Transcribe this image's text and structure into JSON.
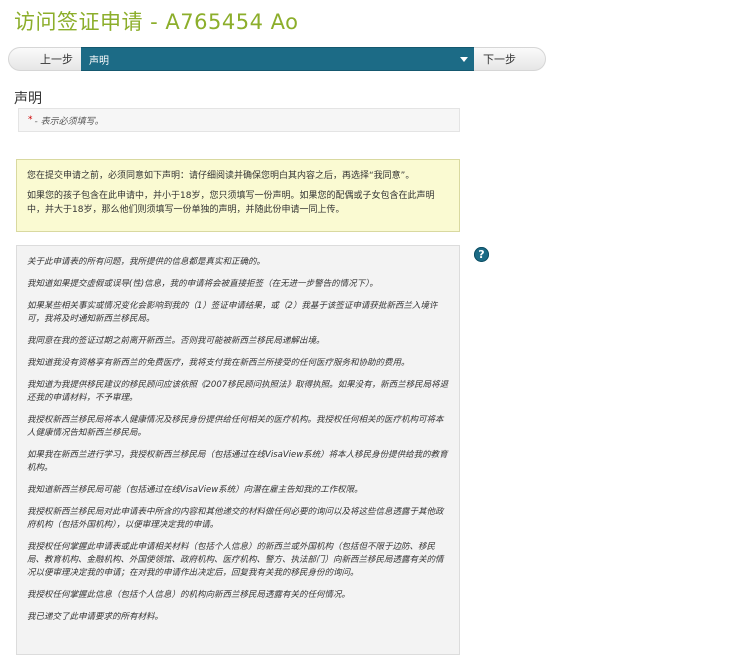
{
  "header": {
    "title": "访问签证申请 - A765454 Ao"
  },
  "nav": {
    "prev_label": "上一步",
    "current_section": "声明",
    "next_label": "下一步"
  },
  "section": {
    "heading": "声明",
    "required_star": "*",
    "required_text": " - 表示必须填写。"
  },
  "notice": {
    "lines": [
      "您在提交申请之前，必须同意如下声明：请仔细阅读并确保您明白其内容之后，再选择“我同意”。",
      "如果您的孩子包含在此申请中，并小于18岁，您只须填写一份声明。如果您的配偶或子女包含在此声明中，并大于18岁，那么他们则须填写一份单独的声明，并随此份申请一同上传。"
    ]
  },
  "declaration": {
    "paragraphs": [
      "关于此申请表的所有问题，我所提供的信息都是真实和正确的。",
      "我知道如果提交虚假或误导(性)信息，我的申请将会被直接拒签（在无进一步警告的情况下）。",
      "如果某些相关事实或情况变化会影响到我的（1）签证申请结果，或（2）我基于该签证申请获批新西兰入境许可，我将及时通知新西兰移民局。",
      "我同意在我的签证过期之前离开新西兰。否则我可能被新西兰移民局递解出境。",
      "我知道我没有资格享有新西兰的免费医疗，我将支付我在新西兰所接受的任何医疗服务和协助的费用。",
      "我知道为我提供移民建议的移民顾问应该依照《2007移民顾问执照法》取得执照。如果没有，新西兰移民局将退还我的申请材料，不予审理。",
      "我授权新西兰移民局将本人健康情况及移民身份提供给任何相关的医疗机构。我授权任何相关的医疗机构可将本人健康情况告知新西兰移民局。",
      "如果我在新西兰进行学习，我授权新西兰移民局（包括通过在线VisaView系统）将本人移民身份提供给我的教育机构。",
      "我知道新西兰移民局可能（包括通过在线VisaView系统）向潜在雇主告知我的工作权限。",
      "我授权新西兰移民局对此申请表中所含的内容和其他递交的材料做任何必要的询问以及将这些信息透露于其他政府机构（包括外国机构），以便审理决定我的申请。",
      "我授权任何掌握此申请表或此申请相关材料（包括个人信息）的新西兰或外国机构（包括但不限于边防、移民局、教育机构、金融机构、外国使领馆、政府机构、医疗机构、警方、执法部门）向新西兰移民局透露有关的情况以便审理决定我的申请；在对我的申请作出决定后，回复我有关我的移民身份的询问。",
      "我授权任何掌握此信息（包括个人信息）的机构向新西兰移民局透露有关的任何情况。",
      "我已递交了此申请要求的所有材料。"
    ]
  },
  "help": {
    "glyph": "?"
  },
  "colors": {
    "title_green": "#8cae2b",
    "nav_teal": "#1c6b86",
    "notice_bg": "#fafad2",
    "decl_bg": "#f3f3f3"
  }
}
